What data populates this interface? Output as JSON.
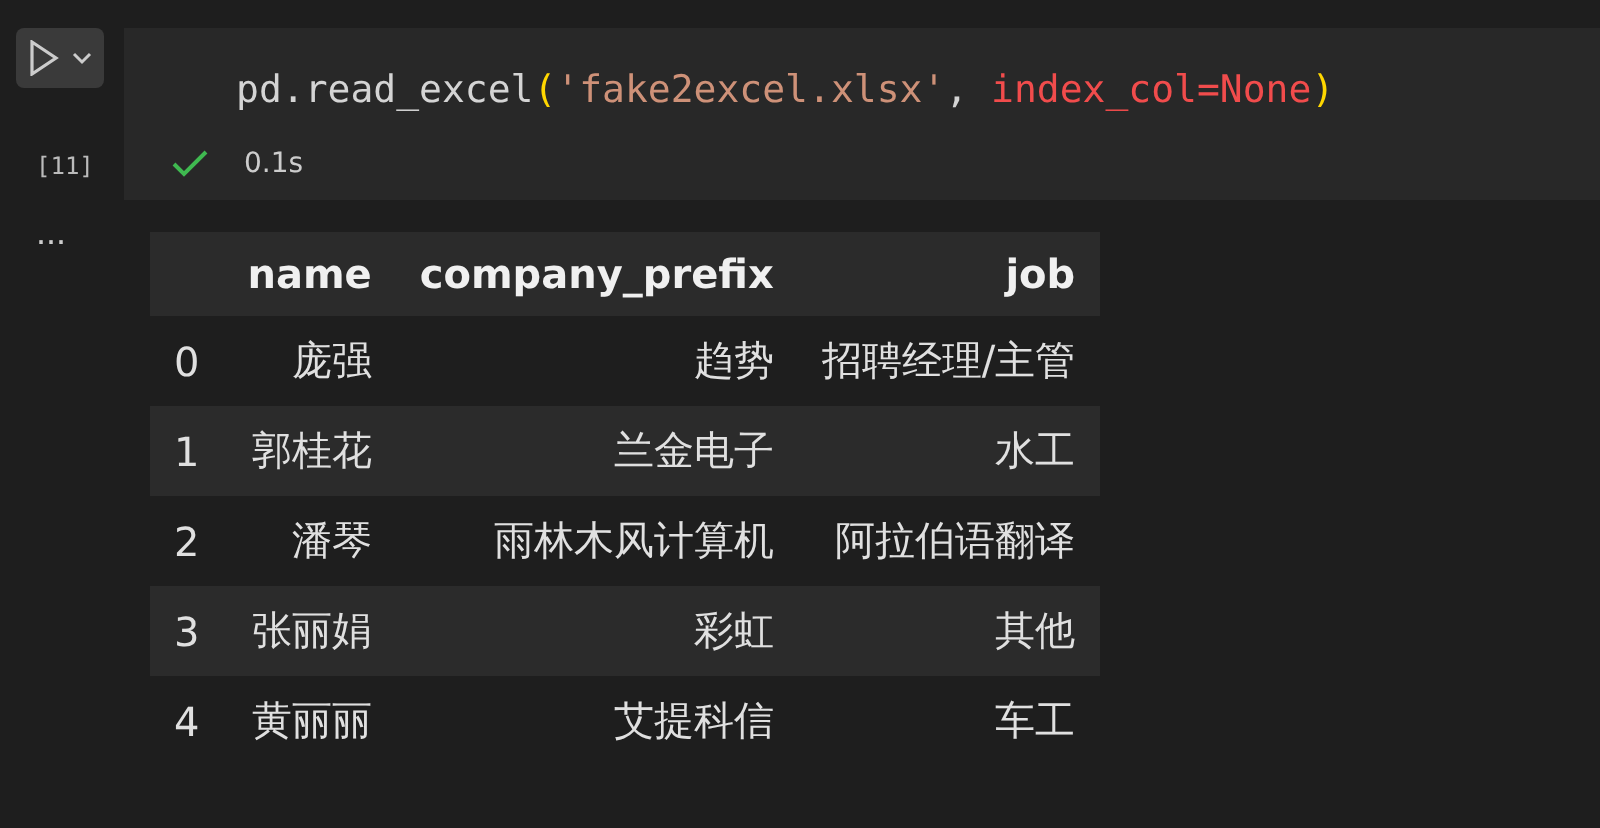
{
  "cell": {
    "execution_count": "[11]",
    "code": [
      {
        "text": "pd.read_excel",
        "kind": "plain"
      },
      {
        "text": "(",
        "kind": "paren"
      },
      {
        "text": "'fake2excel.xlsx'",
        "kind": "string"
      },
      {
        "text": ", ",
        "kind": "plain"
      },
      {
        "text": "index_col=None",
        "kind": "param"
      },
      {
        "text": ")",
        "kind": "paren"
      }
    ],
    "status": "0.1s",
    "succeeded": true,
    "output_menu": "..."
  },
  "table": {
    "columns": [
      "name",
      "company_prefix",
      "job"
    ],
    "rows": [
      {
        "index": "0",
        "cells": [
          "庞强",
          "趋势",
          "招聘经理/主管"
        ]
      },
      {
        "index": "1",
        "cells": [
          "郭桂花",
          "兰金电子",
          "水工"
        ]
      },
      {
        "index": "2",
        "cells": [
          "潘琴",
          "雨林木风计算机",
          "阿拉伯语翻译"
        ]
      },
      {
        "index": "3",
        "cells": [
          "张丽娟",
          "彩虹",
          "其他"
        ]
      },
      {
        "index": "4",
        "cells": [
          "黄丽丽",
          "艾提科信",
          "车工"
        ]
      }
    ]
  }
}
